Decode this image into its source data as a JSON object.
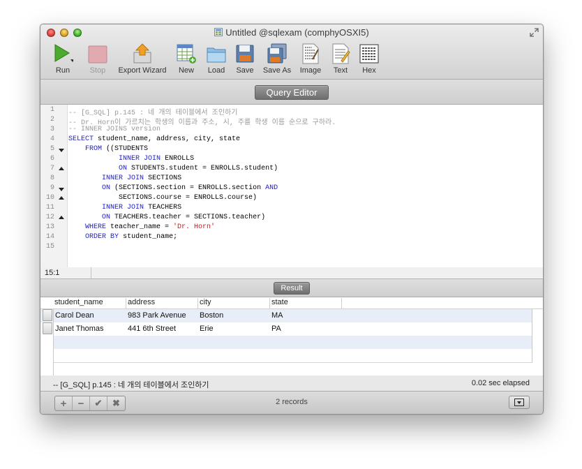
{
  "window": {
    "title": "Untitled @sqlexam (comphyOSXI5)"
  },
  "toolbar": {
    "items": [
      {
        "label": "Run",
        "icon": "play-icon"
      },
      {
        "label": "Stop",
        "icon": "stop-icon"
      },
      {
        "label": "Export Wizard",
        "icon": "export-icon"
      },
      {
        "label": "New",
        "icon": "new-table-icon"
      },
      {
        "label": "Load",
        "icon": "folder-icon"
      },
      {
        "label": "Save",
        "icon": "floppy-icon"
      },
      {
        "label": "Save As",
        "icon": "floppy-multiple-icon"
      },
      {
        "label": "Image",
        "icon": "binary-document-icon"
      },
      {
        "label": "Text",
        "icon": "text-document-icon"
      },
      {
        "label": "Hex",
        "icon": "hex-grid-icon"
      }
    ]
  },
  "editor": {
    "header": "Query Editor",
    "lines": [
      "-- [G_SQL] p.145 : 네 개의 테이블에서 조인하기",
      "-- Dr. Horn이 가르치는 학생의 이름과 주소, 시, 주를 학생 이름 순으로 구하라.",
      "-- INNER JOINS version",
      "SELECT student_name, address, city, state",
      "    FROM ((STUDENTS",
      "            INNER JOIN ENROLLS",
      "            ON STUDENTS.student = ENROLLS.student)",
      "        INNER JOIN SECTIONS",
      "        ON (SECTIONS.section = ENROLLS.section AND",
      "            SECTIONS.course = ENROLLS.course)",
      "        INNER JOIN TEACHERS",
      "        ON TEACHERS.teacher = SECTIONS.teacher)",
      "    WHERE teacher_name = 'Dr. Horn'",
      "    ORDER BY student_name;",
      ""
    ],
    "line_numbers": [
      "1",
      "2",
      "3",
      "4",
      "5",
      "6",
      "7",
      "8",
      "9",
      "10",
      "11",
      "12",
      "13",
      "14",
      "15"
    ],
    "cursor_position": "15:1"
  },
  "result": {
    "header": "Result",
    "columns": [
      "student_name",
      "address",
      "city",
      "state"
    ],
    "rows": [
      [
        "Carol Dean",
        "983 Park Avenue",
        "Boston",
        "MA"
      ],
      [
        "Janet Thomas",
        "441 6th Street",
        "Erie",
        "PA"
      ]
    ],
    "query_comment": "-- [G_SQL] p.145 : 네 개의 테이블에서 조인하기",
    "elapsed": "0.02 sec elapsed",
    "record_count": "2 records"
  },
  "footer": {
    "buttons": [
      {
        "symbol": "+",
        "icon": "plus-icon"
      },
      {
        "symbol": "−",
        "icon": "minus-icon"
      },
      {
        "symbol": "✔",
        "icon": "checkmark-icon"
      },
      {
        "symbol": "✖",
        "icon": "x-icon"
      }
    ]
  },
  "colors": {
    "keyword": "#2020c8",
    "comment": "#9a9a9a",
    "string": "#c02020",
    "row_alt": "#e8eef7"
  }
}
